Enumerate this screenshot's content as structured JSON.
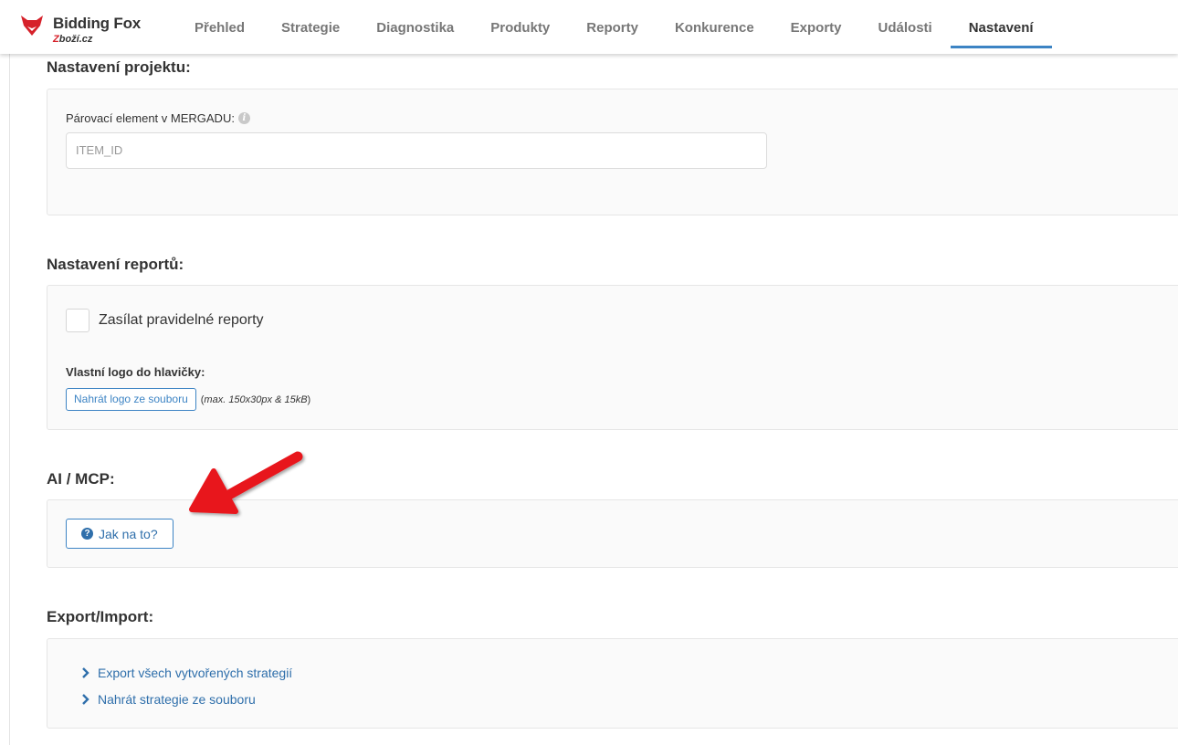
{
  "brand": {
    "name": "Bidding Fox",
    "sub_accent": "Z",
    "sub_rest": "boží.cz"
  },
  "nav": {
    "items": [
      {
        "label": "Přehled",
        "active": false
      },
      {
        "label": "Strategie",
        "active": false
      },
      {
        "label": "Diagnostika",
        "active": false
      },
      {
        "label": "Produkty",
        "active": false
      },
      {
        "label": "Reporty",
        "active": false
      },
      {
        "label": "Konkurence",
        "active": false
      },
      {
        "label": "Exporty",
        "active": false
      },
      {
        "label": "Události",
        "active": false
      },
      {
        "label": "Nastavení",
        "active": true
      }
    ]
  },
  "project_settings": {
    "title": "Nastavení projektu:",
    "pairing_label": "Párovací element v MERGADU:",
    "pairing_value": "ITEM_ID"
  },
  "report_settings": {
    "title": "Nastavení reportů:",
    "send_reports_label": "Zasílat pravidelné reporty",
    "send_reports_checked": false,
    "logo_label": "Vlastní logo do hlavičky:",
    "upload_button": "Nahrát logo ze souboru",
    "upload_hint": "max. 150x30px & 15kB"
  },
  "ai_mcp": {
    "title": "AI / MCP:",
    "help_button": "Jak na to?"
  },
  "export_import": {
    "title": "Export/Import:",
    "links": [
      {
        "label": "Export všech vytvořených strategií"
      },
      {
        "label": "Nahrát strategie ze souboru"
      }
    ]
  },
  "colors": {
    "accent": "#3d84c4",
    "link": "#2f6fab",
    "brand_red": "#d6212a",
    "annotation_arrow": "#e8141c"
  },
  "icons": [
    "fox-logo-icon",
    "info-icon",
    "question-circle-icon",
    "chevron-right-icon",
    "annotation-arrow-icon"
  ]
}
